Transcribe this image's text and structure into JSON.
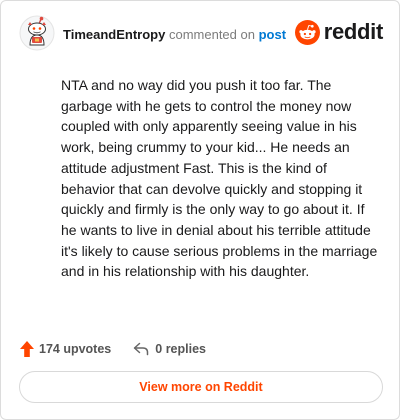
{
  "comment": {
    "author": "TimeandEntropy",
    "action_text": "commented on",
    "target_text": "post",
    "body": "NTA and no way did you push it too far. The garbage with he gets to control the money now coupled with only apparently seeing value in his work, being crummy to your kid... He needs an attitude adjustment Fast. This is the kind of behavior that can devolve quickly and stopping it quickly and firmly is the only way to go about it. If he wants to live in denial about his terrible attitude it's likely to cause serious problems in the marriage and in his relationship with his daughter.",
    "upvotes_label": "174 upvotes",
    "replies_label": "0 replies"
  },
  "brand": {
    "wordmark": "reddit",
    "icon": "reddit-logo-icon",
    "color": "#ff4500"
  },
  "actions": {
    "view_more_label": "View more on Reddit"
  },
  "icons": {
    "avatar": "snoo-avatar-icon",
    "upvote": "upvote-arrow-icon",
    "reply": "reply-arrow-icon"
  },
  "colors": {
    "accent": "#ff4500",
    "link": "#0079d3",
    "text": "#1a1a1b",
    "muted": "#7c7c7c"
  }
}
